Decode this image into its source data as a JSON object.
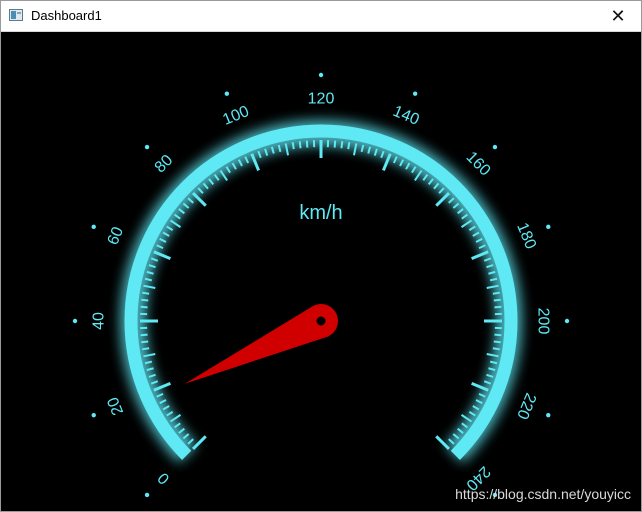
{
  "window": {
    "title": "Dashboard1",
    "close_symbol": "✕"
  },
  "gauge": {
    "unit": "km/h",
    "min": 0,
    "max": 240,
    "major_step": 20,
    "minor_per_major": 10,
    "start_angle_deg": 225,
    "end_angle_deg": -45,
    "value": 18,
    "tick_labels": [
      "0",
      "20",
      "40",
      "60",
      "80",
      "100",
      "120",
      "140",
      "160",
      "180",
      "200",
      "220",
      "240"
    ],
    "colors": {
      "accent": "#5ee9f5",
      "needle": "#d00000",
      "background": "#000000"
    }
  },
  "watermark": "https://blog.csdn.net/youyicc"
}
